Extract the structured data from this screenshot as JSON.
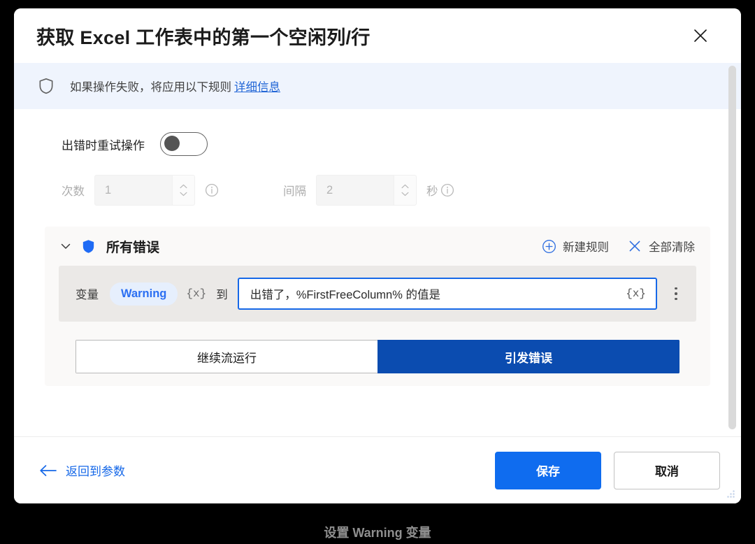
{
  "dialog": {
    "title": "获取 Excel 工作表中的第一个空闲列/行",
    "close_icon": "close-icon"
  },
  "banner": {
    "shield_icon": "shield-outline-icon",
    "text": "如果操作失败，将应用以下规则",
    "link": "详细信息"
  },
  "retry": {
    "toggle_label": "出错时重试操作",
    "toggle_state": "off",
    "count_label": "次数",
    "count_value": "1",
    "interval_label": "间隔",
    "interval_value": "2",
    "unit_label": "秒",
    "info_icon": "info-circle-icon",
    "spinner_up_icon": "caret-up-icon",
    "spinner_down_icon": "caret-down-icon"
  },
  "rules": {
    "chevron_icon": "chevron-down-icon",
    "shield_icon": "shield-filled-icon",
    "title": "所有错误",
    "new_rule": {
      "icon": "plus-circle-icon",
      "label": "新建规则"
    },
    "clear_all": {
      "icon": "close-icon",
      "label": "全部清除"
    },
    "variable_row": {
      "label": "变量",
      "chip": "Warning",
      "chip_token": "{x}",
      "to_label": "到",
      "input_value": "出错了，%FirstFreeColumn% 的值是",
      "input_token": "{x}",
      "menu_icon": "more-vertical-icon"
    },
    "segmented": {
      "options": [
        {
          "label": "继续流运行",
          "selected": false
        },
        {
          "label": "引发错误",
          "selected": true
        }
      ]
    }
  },
  "footer": {
    "back_icon": "arrow-left-icon",
    "back_label": "返回到参数",
    "save_label": "保存",
    "cancel_label": "取消",
    "resize_icon": "resize-grip-icon"
  },
  "caption": "设置 Warning 变量",
  "colors": {
    "accent_blue": "#0f6cef",
    "segment_selected_blue": "#0b4cb0",
    "banner_bg": "#eff4fd",
    "card_bg": "#faf9f8",
    "row_bg": "#ebe9e7",
    "chip_bg": "#e6effd",
    "chip_text": "#2b6ff2",
    "focus_border": "#1668e8"
  }
}
